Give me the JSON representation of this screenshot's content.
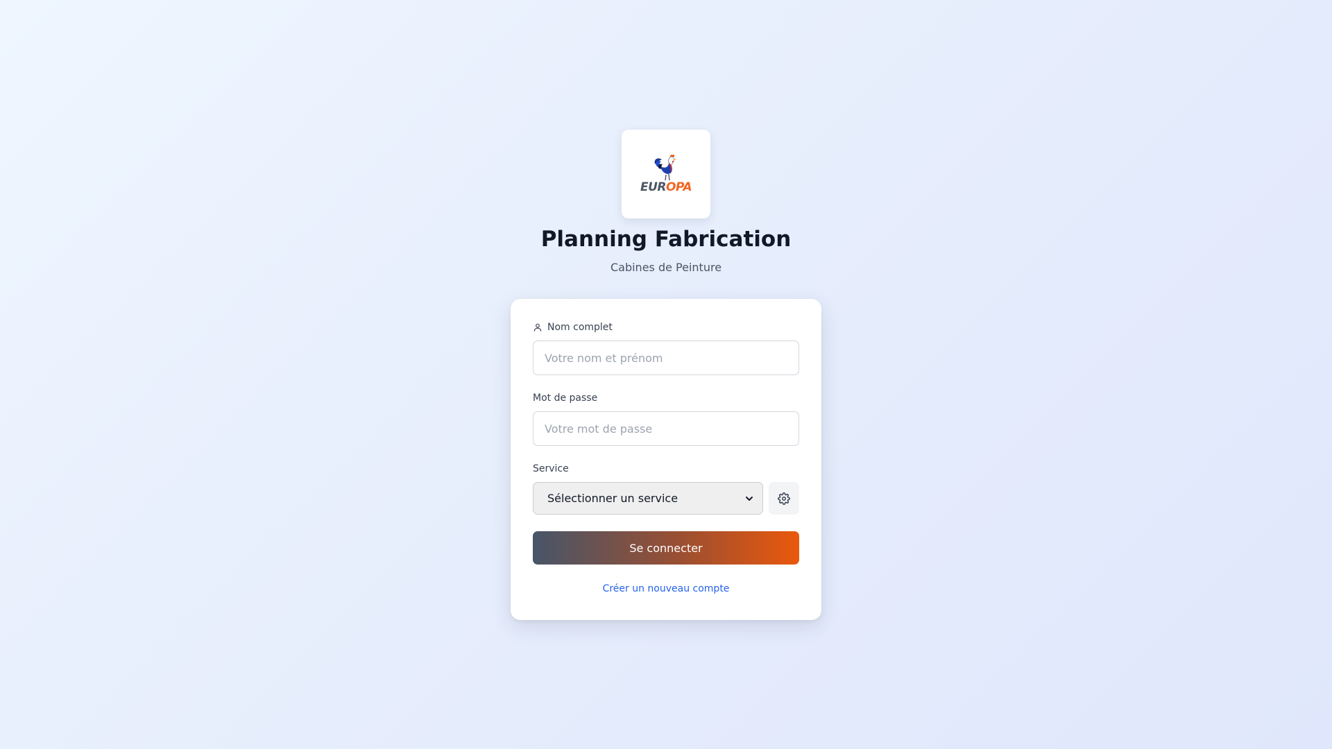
{
  "brand": {
    "logo_part1": "EUR",
    "logo_part2": "OPA",
    "logo_icon": "rooster-icon",
    "accent_color": "#ea580c",
    "secondary_color": "#475569"
  },
  "header": {
    "title": "Planning Fabrication",
    "subtitle": "Cabines de Peinture"
  },
  "form": {
    "name_label": "Nom complet",
    "name_icon": "user-icon",
    "name_placeholder": "Votre nom et prénom",
    "password_label": "Mot de passe",
    "password_placeholder": "Votre mot de passe",
    "service_label": "Service",
    "service_selected": "Sélectionner un service",
    "service_settings_icon": "gear-icon",
    "submit_label": "Se connecter",
    "create_account_link": "Créer un nouveau compte",
    "link_color": "#2563eb"
  }
}
